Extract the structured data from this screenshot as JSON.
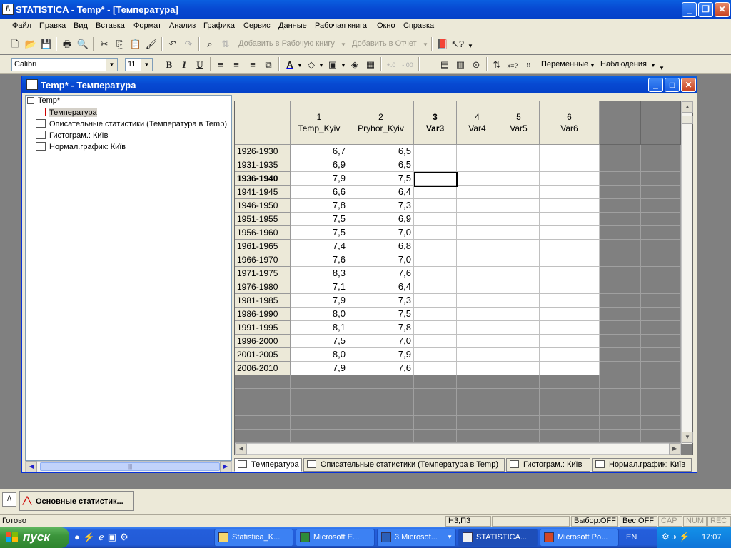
{
  "app": {
    "title": "STATISTICA - Temp* - [Температура]",
    "icon_name": "statistica-app-icon"
  },
  "menu": [
    "Файл",
    "Правка",
    "Вид",
    "Вставка",
    "Формат",
    "Анализ",
    "Графика",
    "Сервис",
    "Данные",
    "Рабочая книга",
    "Окно",
    "Справка"
  ],
  "toolbar1": {
    "add_workbook_label": "Добавить в Рабочую книгу",
    "add_report_label": "Добавить в Отчет"
  },
  "toolbar2": {
    "font_name": "Calibri",
    "font_size": "11",
    "bold": "B",
    "italic": "I",
    "underline": "U",
    "variables_label": "Переменные",
    "cases_label": "Наблюдения",
    "xeq_label": "x=?"
  },
  "child": {
    "title": "Temp* - Температура"
  },
  "tree": {
    "root": "Temp*",
    "items": [
      {
        "label": "Температура",
        "icon": "spreadsheet-icon",
        "selected": true
      },
      {
        "label": "Описательные статистики (Температура в Temp)",
        "icon": "table-icon",
        "selected": false
      },
      {
        "label": "Гистограм.: Київ",
        "icon": "graph-icon",
        "selected": false
      },
      {
        "label": "Нормал.график: Київ",
        "icon": "graph-icon",
        "selected": false
      }
    ],
    "hscroll_grip": "|||"
  },
  "sheet": {
    "columns": [
      {
        "num": "1",
        "name": "Temp_Kyiv",
        "bold": false
      },
      {
        "num": "2",
        "name": "Pryhor_Kyiv",
        "bold": false
      },
      {
        "num": "3",
        "name": "Var3",
        "bold": true
      },
      {
        "num": "4",
        "name": "Var4",
        "bold": false
      },
      {
        "num": "5",
        "name": "Var5",
        "bold": false
      },
      {
        "num": "6",
        "name": "Var6",
        "bold": false
      }
    ],
    "rows": [
      {
        "label": "1926-1930",
        "values": [
          "6,7",
          "6,5"
        ]
      },
      {
        "label": "1931-1935",
        "values": [
          "6,9",
          "6,5"
        ]
      },
      {
        "label": "1936-1940",
        "values": [
          "7,9",
          "7,5"
        ],
        "bold": true
      },
      {
        "label": "1941-1945",
        "values": [
          "6,6",
          "6,4"
        ]
      },
      {
        "label": "1946-1950",
        "values": [
          "7,8",
          "7,3"
        ]
      },
      {
        "label": "1951-1955",
        "values": [
          "7,5",
          "6,9"
        ]
      },
      {
        "label": "1956-1960",
        "values": [
          "7,5",
          "7,0"
        ]
      },
      {
        "label": "1961-1965",
        "values": [
          "7,4",
          "6,8"
        ]
      },
      {
        "label": "1966-1970",
        "values": [
          "7,6",
          "7,0"
        ]
      },
      {
        "label": "1971-1975",
        "values": [
          "8,3",
          "7,6"
        ]
      },
      {
        "label": "1976-1980",
        "values": [
          "7,1",
          "6,4"
        ]
      },
      {
        "label": "1981-1985",
        "values": [
          "7,9",
          "7,3"
        ]
      },
      {
        "label": "1986-1990",
        "values": [
          "8,0",
          "7,5"
        ]
      },
      {
        "label": "1991-1995",
        "values": [
          "8,1",
          "7,8"
        ]
      },
      {
        "label": "1996-2000",
        "values": [
          "7,5",
          "7,0"
        ]
      },
      {
        "label": "2001-2005",
        "values": [
          "8,0",
          "7,9"
        ]
      },
      {
        "label": "2006-2010",
        "values": [
          "7,9",
          "7,6"
        ]
      }
    ]
  },
  "tabs": [
    {
      "label": "Температура",
      "active": true
    },
    {
      "label": "Описательные статистики (Температура в Temp)",
      "active": false
    },
    {
      "label": "Гистограм.: Київ",
      "active": false
    },
    {
      "label": "Нормал.график: Київ",
      "active": false
    }
  ],
  "minimized": {
    "label": "Основные статистик..."
  },
  "status": {
    "ready": "Готово",
    "cell": "Н3,П3",
    "selection": "Выбор:OFF",
    "weight": "Вес:OFF",
    "cap": "CAP",
    "num": "NUM",
    "rec": "REC"
  },
  "taskbar": {
    "start": "пуск",
    "tasks": [
      {
        "label": "Statistica_K...",
        "icon": "folder-icon"
      },
      {
        "label": "Microsoft E...",
        "icon": "excel-icon"
      },
      {
        "label": "3 Microsof...",
        "icon": "word-icon"
      },
      {
        "label": "STATISTICA...",
        "icon": "statistica-icon",
        "active": true
      },
      {
        "label": "Microsoft Po...",
        "icon": "powerpoint-icon"
      }
    ],
    "lang": "EN",
    "clock": "17:07"
  },
  "colors": {
    "title_blue": "#0749d2",
    "workspace_gray": "#808080",
    "xp_face": "#ece9d8",
    "start_green": "#3c953c"
  }
}
